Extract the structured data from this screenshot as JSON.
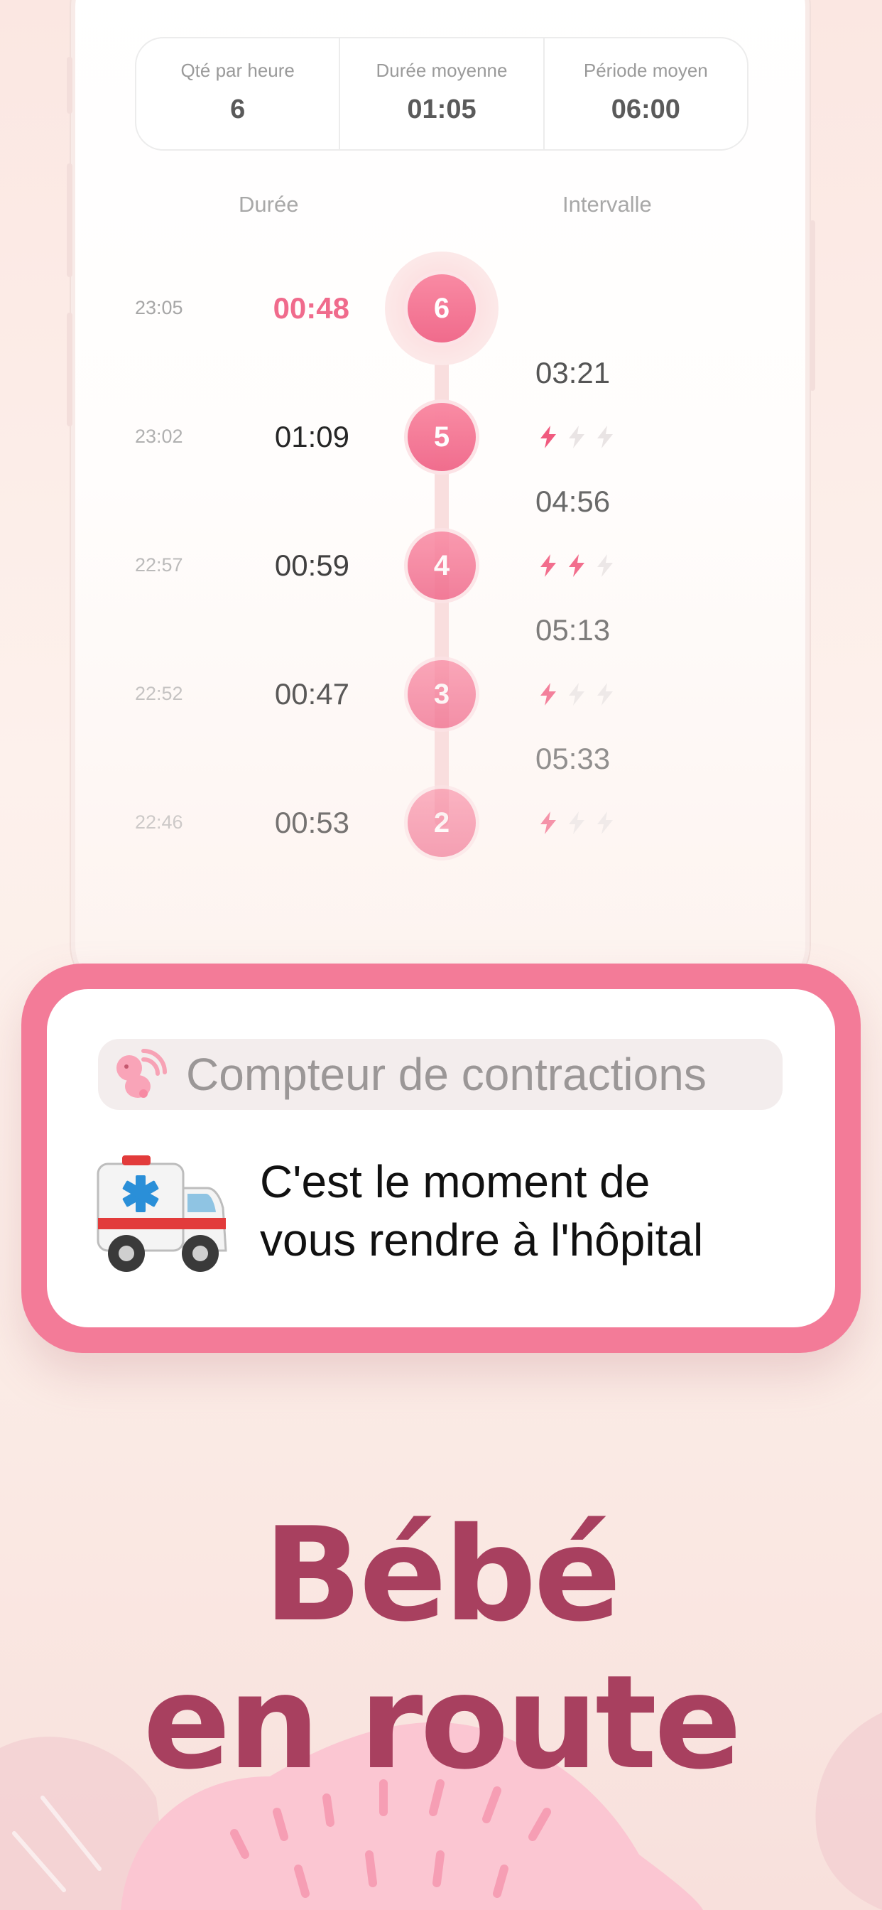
{
  "stats": [
    {
      "label": "Qté par heure",
      "value": "6"
    },
    {
      "label": "Durée moyenne",
      "value": "01:05"
    },
    {
      "label": "Période moyen",
      "value": "06:00"
    }
  ],
  "columns": {
    "duration": "Durée",
    "interval": "Intervalle"
  },
  "contractions": [
    {
      "time": "23:05",
      "duration": "00:48",
      "number": "6",
      "intensity": null
    },
    {
      "time": "23:02",
      "duration": "01:09",
      "number": "5",
      "intensity": 1
    },
    {
      "time": "22:57",
      "duration": "00:59",
      "number": "4",
      "intensity": 2
    },
    {
      "time": "22:52",
      "duration": "00:47",
      "number": "3",
      "intensity": 1
    },
    {
      "time": "22:46",
      "duration": "00:53",
      "number": "2",
      "intensity": 1
    }
  ],
  "intervals": [
    "03:21",
    "04:56",
    "05:13",
    "05:33"
  ],
  "notification": {
    "app_name": "Compteur de contractions",
    "message_line1": "C'est le moment de",
    "message_line2": "vous rendre à l'hôpital"
  },
  "headline": {
    "line1": "Bébé",
    "line2": "en route"
  },
  "colors": {
    "accent": "#f06b8c",
    "headline": "#a8405f",
    "bolt_on": "#f0577c",
    "bolt_off": "#e9e4e4"
  },
  "icons": {
    "notification_emoji": "ambulance",
    "app_icon": "baby-fetus-icon",
    "intensity": "lightning-bolt-icon"
  }
}
